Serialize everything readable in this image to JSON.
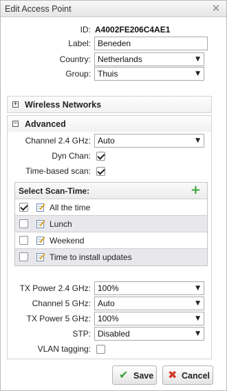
{
  "dialog": {
    "title": "Edit Access Point",
    "close_glyph": "✕"
  },
  "general": {
    "id_label": "ID:",
    "id_value": "A4002FE206C4AE1",
    "label_label": "Label:",
    "label_value": "Beneden",
    "country_label": "Country:",
    "country_value": "Netherlands",
    "group_label": "Group:",
    "group_value": "Thuis"
  },
  "panels": {
    "wireless": {
      "title": "Wireless Networks",
      "toggle": "+",
      "expanded": false
    },
    "advanced": {
      "title": "Advanced",
      "toggle": "−",
      "expanded": true
    }
  },
  "advanced": {
    "channel24_label": "Channel 2.4 GHz:",
    "channel24_value": "Auto",
    "dynchan_label": "Dyn Chan:",
    "dynchan_checked": true,
    "timescan_label": "Time-based scan:",
    "timescan_checked": true,
    "scan_title": "Select Scan-Time:",
    "scan_add_glyph": "+",
    "scan_items": [
      {
        "label": "All the time",
        "checked": true
      },
      {
        "label": "Lunch",
        "checked": false
      },
      {
        "label": "Weekend",
        "checked": false
      },
      {
        "label": "Time to install updates",
        "checked": false
      }
    ],
    "txpower24_label": "TX Power 2.4 GHz:",
    "txpower24_value": "100%",
    "channel5_label": "Channel 5 GHz:",
    "channel5_value": "Auto",
    "txpower5_label": "TX Power 5 GHz:",
    "txpower5_value": "100%",
    "stp_label": "STP:",
    "stp_value": "Disabled",
    "vlan_label": "VLAN tagging:",
    "vlan_checked": false
  },
  "buttons": {
    "save_label": "Save",
    "save_icon": "✔",
    "cancel_label": "Cancel",
    "cancel_icon": "✖"
  },
  "colors": {
    "save_icon": "#3aa135",
    "cancel_icon": "#d23a2a",
    "add_icon": "#3aa135"
  },
  "icons": {
    "close": "close-icon",
    "expand": "expand-icon",
    "collapse": "collapse-icon",
    "add": "plus-icon",
    "edit": "edit-icon",
    "dropdown": "chevron-down-icon",
    "save": "checkmark-icon",
    "cancel": "cross-icon"
  }
}
